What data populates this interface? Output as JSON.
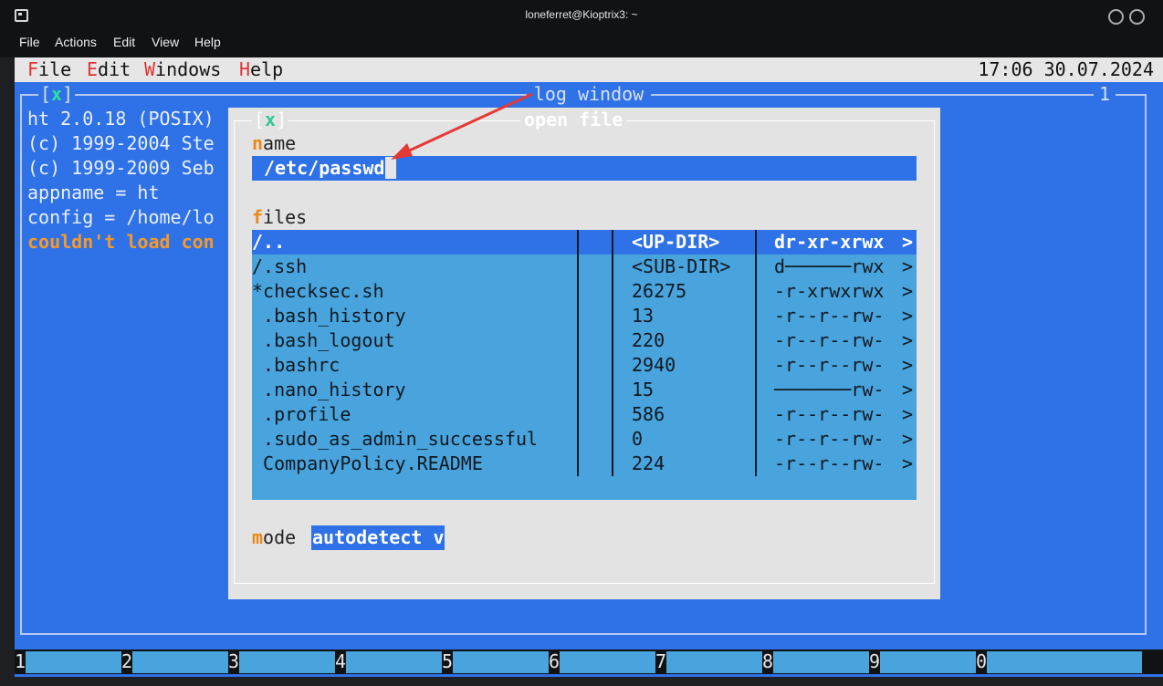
{
  "window": {
    "title": "loneferret@Kioptrix3: ~",
    "menu": [
      "File",
      "Actions",
      "Edit",
      "View",
      "Help"
    ]
  },
  "ht_menu": {
    "items": [
      {
        "hot": "F",
        "rest": "ile"
      },
      {
        "hot": "E",
        "rest": "dit"
      },
      {
        "hot": "W",
        "rest": "indows"
      },
      {
        "hot": "H",
        "rest": "elp"
      }
    ],
    "clock": "17:06 30.07.2024"
  },
  "log_window": {
    "close": "x",
    "title": "log window",
    "number": "1",
    "lines": [
      "ht 2.0.18 (POSIX)",
      "(c) 1999-2004 Ste",
      "(c) 1999-2009 Seb",
      "appname = ht",
      "config = /home/lo"
    ],
    "warning": "couldn't load con"
  },
  "dialog": {
    "close": "x",
    "title": "open file",
    "name_label": {
      "hot": "n",
      "rest": "ame"
    },
    "name_value": "/etc/passwd",
    "files_label": {
      "hot": "f",
      "rest": "iles"
    },
    "mode_label": {
      "hot": "m",
      "rest": "ode"
    },
    "mode_value": "autodetect v",
    "files": [
      {
        "name": "/..",
        "size": "<UP-DIR>",
        "perm": "dr-xr-xrwx",
        "more": ">"
      },
      {
        "name": "/.ssh",
        "size": "<SUB-DIR>",
        "perm": "d──────rwx",
        "more": ">"
      },
      {
        "name": "*checksec.sh",
        "size": "26275",
        "perm": "-r-xrwxrwx",
        "more": ">"
      },
      {
        "name": " .bash_history",
        "size": "13",
        "perm": "-r--r--rw-",
        "more": ">"
      },
      {
        "name": " .bash_logout",
        "size": "220",
        "perm": "-r--r--rw-",
        "more": ">"
      },
      {
        "name": " .bashrc",
        "size": "2940",
        "perm": "-r--r--rw-",
        "more": ">"
      },
      {
        "name": " .nano_history",
        "size": "15",
        "perm": "───────rw-",
        "more": ">"
      },
      {
        "name": " .profile",
        "size": "586",
        "perm": "-r--r--rw-",
        "more": ">"
      },
      {
        "name": " .sudo_as_admin_successful",
        "size": "0",
        "perm": "-r--r--rw-",
        "more": ">"
      },
      {
        "name": " CompanyPolicy.README",
        "size": "224",
        "perm": "-r--r--rw-",
        "more": ">"
      }
    ]
  },
  "fkeys": [
    "1",
    "2",
    "3",
    "4",
    "5",
    "6",
    "7",
    "8",
    "9",
    "0"
  ],
  "colors": {
    "editor_bg": "#2f71e6",
    "dialog_bg": "#e3e3e3",
    "list_bg": "#49a4dd",
    "accent": "#e8891a",
    "annotation_arrow": "#e53935"
  }
}
